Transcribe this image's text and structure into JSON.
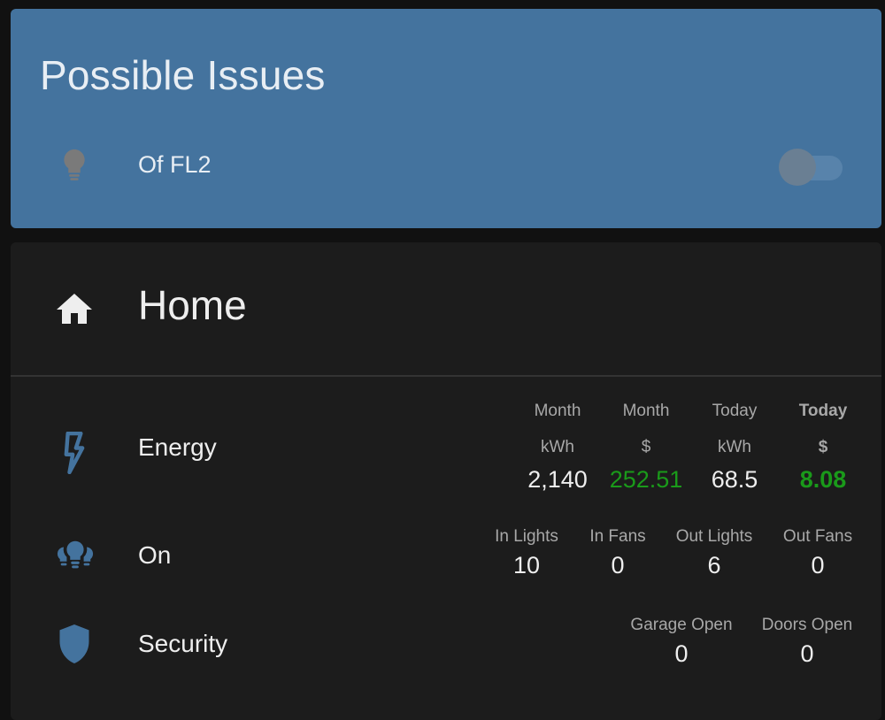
{
  "issues_card": {
    "title": "Possible Issues",
    "item": {
      "icon": "lightbulb-icon",
      "label": "Of FL2",
      "toggle_state": "off"
    }
  },
  "home_card": {
    "title": "Home",
    "icon": "home-icon",
    "energy": {
      "label": "Energy",
      "icon": "lightning-bolt-icon",
      "columns": [
        {
          "h1": "Month",
          "h2": "kWh",
          "value": "2,140"
        },
        {
          "h1": "Month",
          "h2": "$",
          "value": "252.51"
        },
        {
          "h1": "Today",
          "h2": "kWh",
          "value": "68.5"
        },
        {
          "h1": "Today",
          "h2": "$",
          "value": "8.08"
        }
      ]
    },
    "on": {
      "label": "On",
      "icon": "lights-group-icon",
      "columns": [
        {
          "h": "In Lights",
          "value": "10"
        },
        {
          "h": "In Fans",
          "value": "0"
        },
        {
          "h": "Out Lights",
          "value": "6"
        },
        {
          "h": "Out Fans",
          "value": "0"
        }
      ]
    },
    "security": {
      "label": "Security",
      "icon": "shield-icon",
      "columns": [
        {
          "h": "Garage Open",
          "value": "0"
        },
        {
          "h": "Doors Open",
          "value": "0"
        }
      ]
    }
  },
  "colors": {
    "issues_bg": "#44739e",
    "card_bg": "#1c1c1c",
    "accent_icon": "#44739e",
    "positive_value": "#1a9a1a"
  }
}
